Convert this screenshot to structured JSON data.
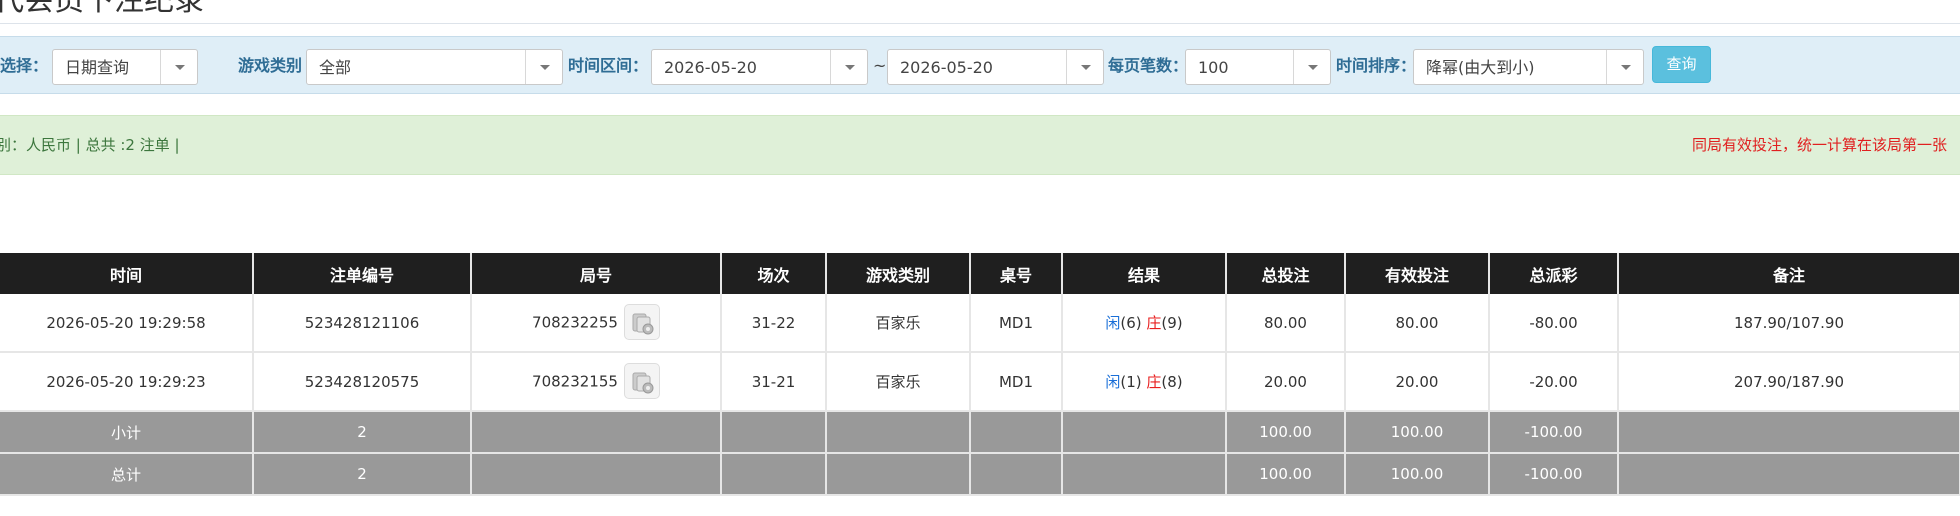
{
  "page": {
    "title": "代会员下注纪录"
  },
  "filters": {
    "select_label": "选择：",
    "select_value": "日期查询",
    "game_type_label": "游戏类别",
    "game_type_value": "全部",
    "time_range_label": "时间区间：",
    "date_from": "2026-05-20",
    "date_sep": "~",
    "date_to": "2026-05-20",
    "per_page_label": "每页笔数：",
    "per_page_value": "100",
    "sort_label": "时间排序：",
    "sort_value": "降幂(由大到小)",
    "query_button": "查询"
  },
  "info": {
    "left": "别：人民币 | 总共 :2 注单 |",
    "right": "同局有效投注，统一计算在该局第一张"
  },
  "table": {
    "headers": [
      "时间",
      "注单编号",
      "局号",
      "场次",
      "游戏类别",
      "桌号",
      "结果",
      "总投注",
      "有效投注",
      "总派彩",
      "备注"
    ],
    "rows": [
      {
        "time": "2026-05-20 19:29:58",
        "bet_no": "523428121106",
        "round_no": "708232255",
        "session": "31-22",
        "game": "百家乐",
        "table": "MD1",
        "player_label": "闲",
        "player_val": "(6)",
        "banker_label": "庄",
        "banker_val": "(9)",
        "total_bet": "80.00",
        "valid_bet": "80.00",
        "payout": "-80.00",
        "remark": "187.90/107.90"
      },
      {
        "time": "2026-05-20 19:29:23",
        "bet_no": "523428120575",
        "round_no": "708232155",
        "session": "31-21",
        "game": "百家乐",
        "table": "MD1",
        "player_label": "闲",
        "player_val": "(1)",
        "banker_label": "庄",
        "banker_val": "(8)",
        "total_bet": "20.00",
        "valid_bet": "20.00",
        "payout": "-20.00",
        "remark": "207.90/187.90"
      }
    ],
    "subtotal": {
      "label": "小计",
      "count": "2",
      "total_bet": "100.00",
      "valid_bet": "100.00",
      "payout": "-100.00"
    },
    "grand_total": {
      "label": "总计",
      "count": "2",
      "total_bet": "100.00",
      "valid_bet": "100.00",
      "payout": "-100.00"
    }
  },
  "icons": {
    "round_detail": "card-detail-icon",
    "dropdown": "caret-down-icon"
  }
}
